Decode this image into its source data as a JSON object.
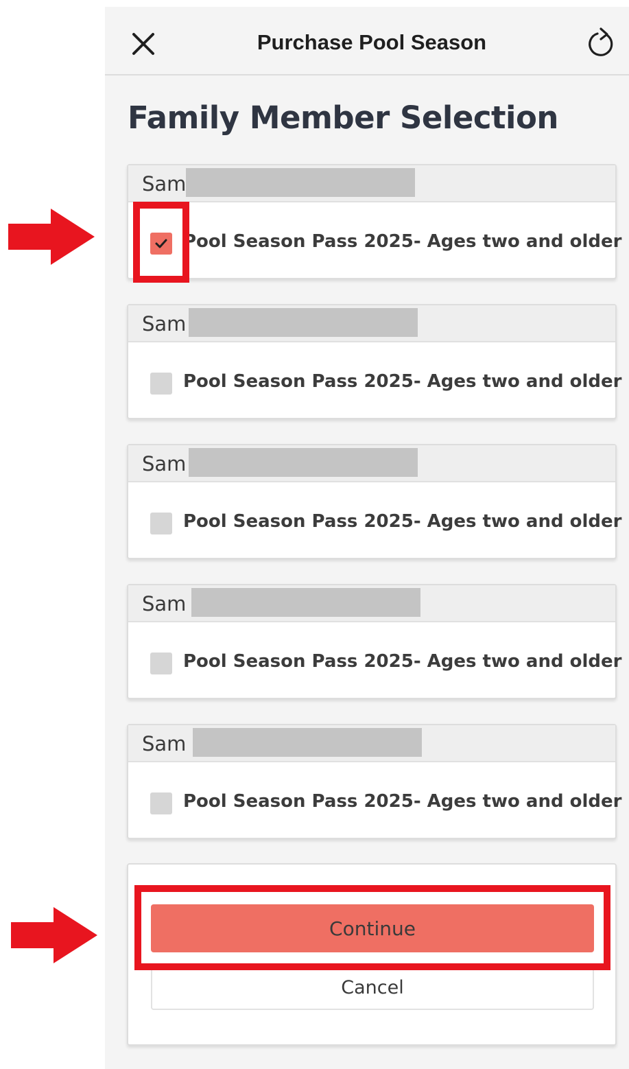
{
  "header": {
    "title": "Purchase Pool Season",
    "close_icon": "close-icon",
    "refresh_icon": "refresh-icon"
  },
  "page": {
    "title": "Family Member Selection"
  },
  "members": [
    {
      "name": "Sam",
      "option": "Pool Season Pass 2025- Ages two and older",
      "checked": true
    },
    {
      "name": "Sam",
      "option": "Pool Season Pass 2025- Ages two and older",
      "checked": false
    },
    {
      "name": "Sam",
      "option": "Pool Season Pass 2025- Ages two and older",
      "checked": false
    },
    {
      "name": "Sam",
      "option": "Pool Season Pass 2025- Ages two and older",
      "checked": false
    },
    {
      "name": "Sam",
      "option": "Pool Season Pass 2025- Ages two and older",
      "checked": false
    }
  ],
  "actions": {
    "continue_label": "Continue",
    "cancel_label": "Cancel"
  },
  "colors": {
    "accent": "#ef6f63",
    "annotation_red": "#e8151f",
    "background": "#f4f4f4"
  }
}
